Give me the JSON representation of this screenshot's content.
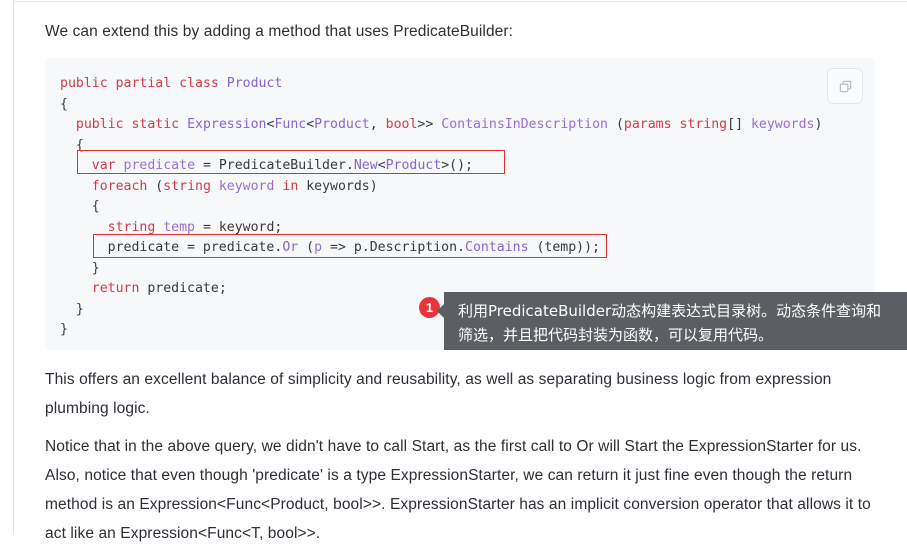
{
  "intro": {
    "text": "We can extend this by adding a method that uses PredicateBuilder:"
  },
  "code_block": {
    "language": "csharp",
    "copy_button_label": "copy-icon",
    "lines": [
      "public partial class Product",
      "{",
      "  public static Expression<Func<Product, bool>> ContainsInDescription (params string[] keywords)",
      "  {",
      "    var predicate = PredicateBuilder.New<Product>();",
      "    foreach (string keyword in keywords)",
      "    {",
      "      string temp = keyword;",
      "      predicate = predicate.Or (p => p.Description.Contains (temp));",
      "    }",
      "    return predicate;",
      "  }",
      "}"
    ],
    "highlight_color": "#e03131",
    "highlighted_lines": [
      "var predicate = PredicateBuilder.New<Product>();",
      "predicate = predicate.Or (p => p.Description.Contains (temp));"
    ],
    "background": "#f7f8f9"
  },
  "annotation": {
    "number": "1",
    "badge_color": "#e8343c",
    "tooltip_background": "#5b5f63",
    "text": "利用PredicateBuilder动态构建表达式目录树。动态条件查询和筛选，并且把代码封装为函数，可以复用代码。"
  },
  "paragraphs": {
    "p1": "This offers an excellent balance of simplicity and reusability, as well as separating business logic from expression plumbing logic.",
    "p2": "Notice that in the above query, we didn't have to call Start, as the first call to Or will Start the ExpressionStarter for us. Also, notice that even though 'predicate' is a type ExpressionStarter, we can return it just fine even though the return method is an Expression<Func<Product, bool>>. ExpressionStarter has an implicit conversion operator that allows it to act like an Expression<Func<T, bool>>."
  }
}
